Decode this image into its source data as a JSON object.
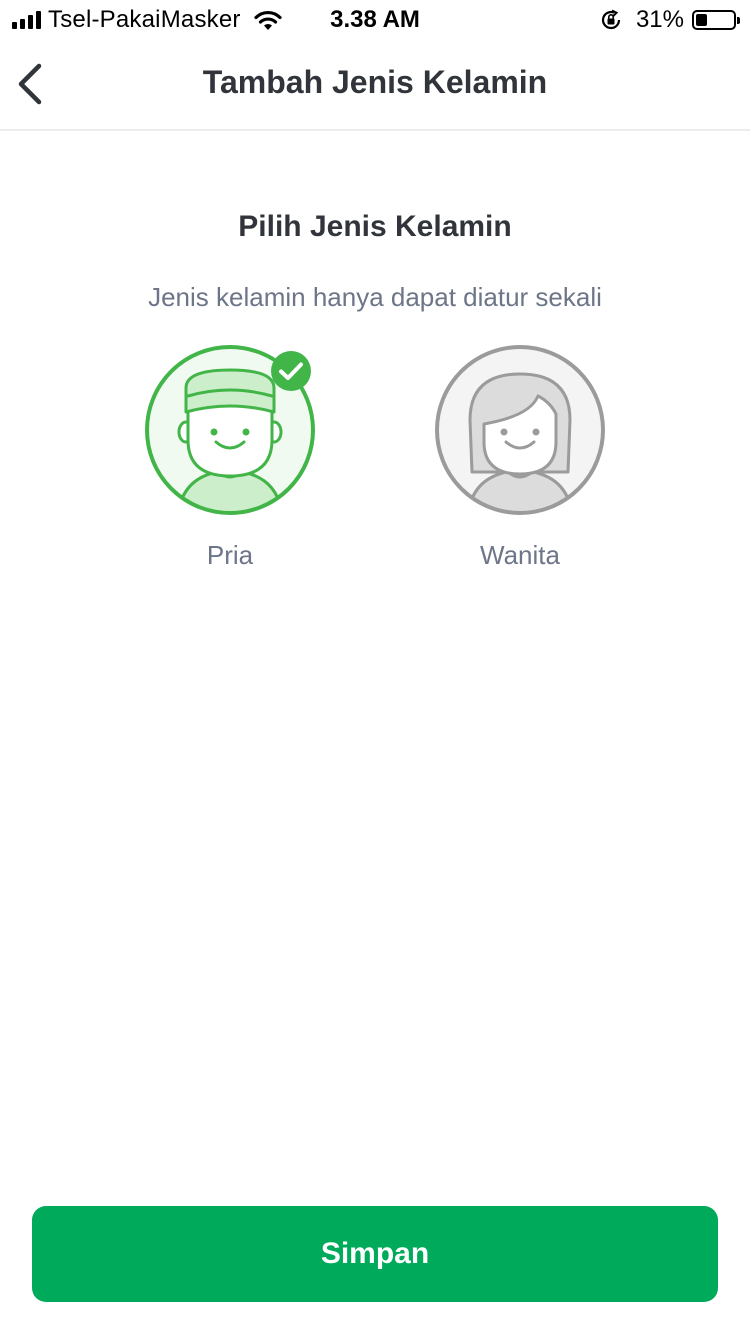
{
  "status_bar": {
    "carrier": "Tsel-PakaiMasker",
    "time": "3.38 AM",
    "battery_percent": "31%",
    "battery_level": 0.31,
    "icons": [
      "signal-icon",
      "wifi-icon",
      "orientation-lock-icon",
      "battery-icon"
    ]
  },
  "header": {
    "title": "Tambah Jenis Kelamin",
    "back_icon": "chevron-left-icon"
  },
  "content": {
    "title": "Pilih Jenis Kelamin",
    "subtitle": "Jenis kelamin hanya dapat diatur sekali"
  },
  "options": [
    {
      "label": "Pria",
      "icon": "male-avatar-icon",
      "selected": true
    },
    {
      "label": "Wanita",
      "icon": "female-avatar-icon",
      "selected": false
    }
  ],
  "actions": {
    "save_label": "Simpan"
  },
  "colors": {
    "primary": "#00aa5b",
    "selected_outline": "#42b549",
    "unselected_outline": "#9b9b9b",
    "text_primary": "#31353b",
    "text_secondary": "#6d7588"
  }
}
